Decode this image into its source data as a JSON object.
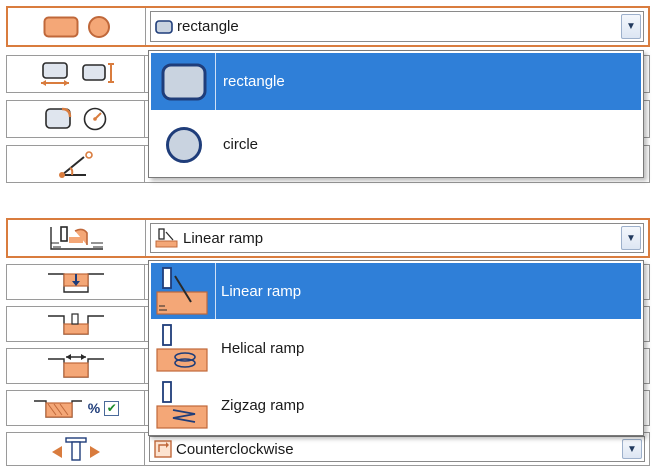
{
  "shape_panel": {
    "selected_value": "rectangle",
    "options": [
      {
        "label": "rectangle",
        "icon": "rectangle-icon",
        "selected": true
      },
      {
        "label": "circle",
        "icon": "circle-icon",
        "selected": false
      }
    ]
  },
  "ramp_panel": {
    "selected_value": "Linear ramp",
    "options": [
      {
        "label": "Linear ramp",
        "icon": "linear-ramp-icon",
        "selected": true
      },
      {
        "label": "Helical ramp",
        "icon": "helical-ramp-icon",
        "selected": false
      },
      {
        "label": "Zigzag ramp",
        "icon": "zigzag-ramp-icon",
        "selected": false
      }
    ],
    "percent_label": "%",
    "percent_checked": true
  },
  "direction": {
    "selected_value": "Counterclockwise",
    "icon": "counterclockwise-icon"
  },
  "colors": {
    "accent": "#d97c3e",
    "selection": "#2f7fd8",
    "icon_fill": "#c9d3e0",
    "icon_stroke": "#1f3d7a"
  }
}
